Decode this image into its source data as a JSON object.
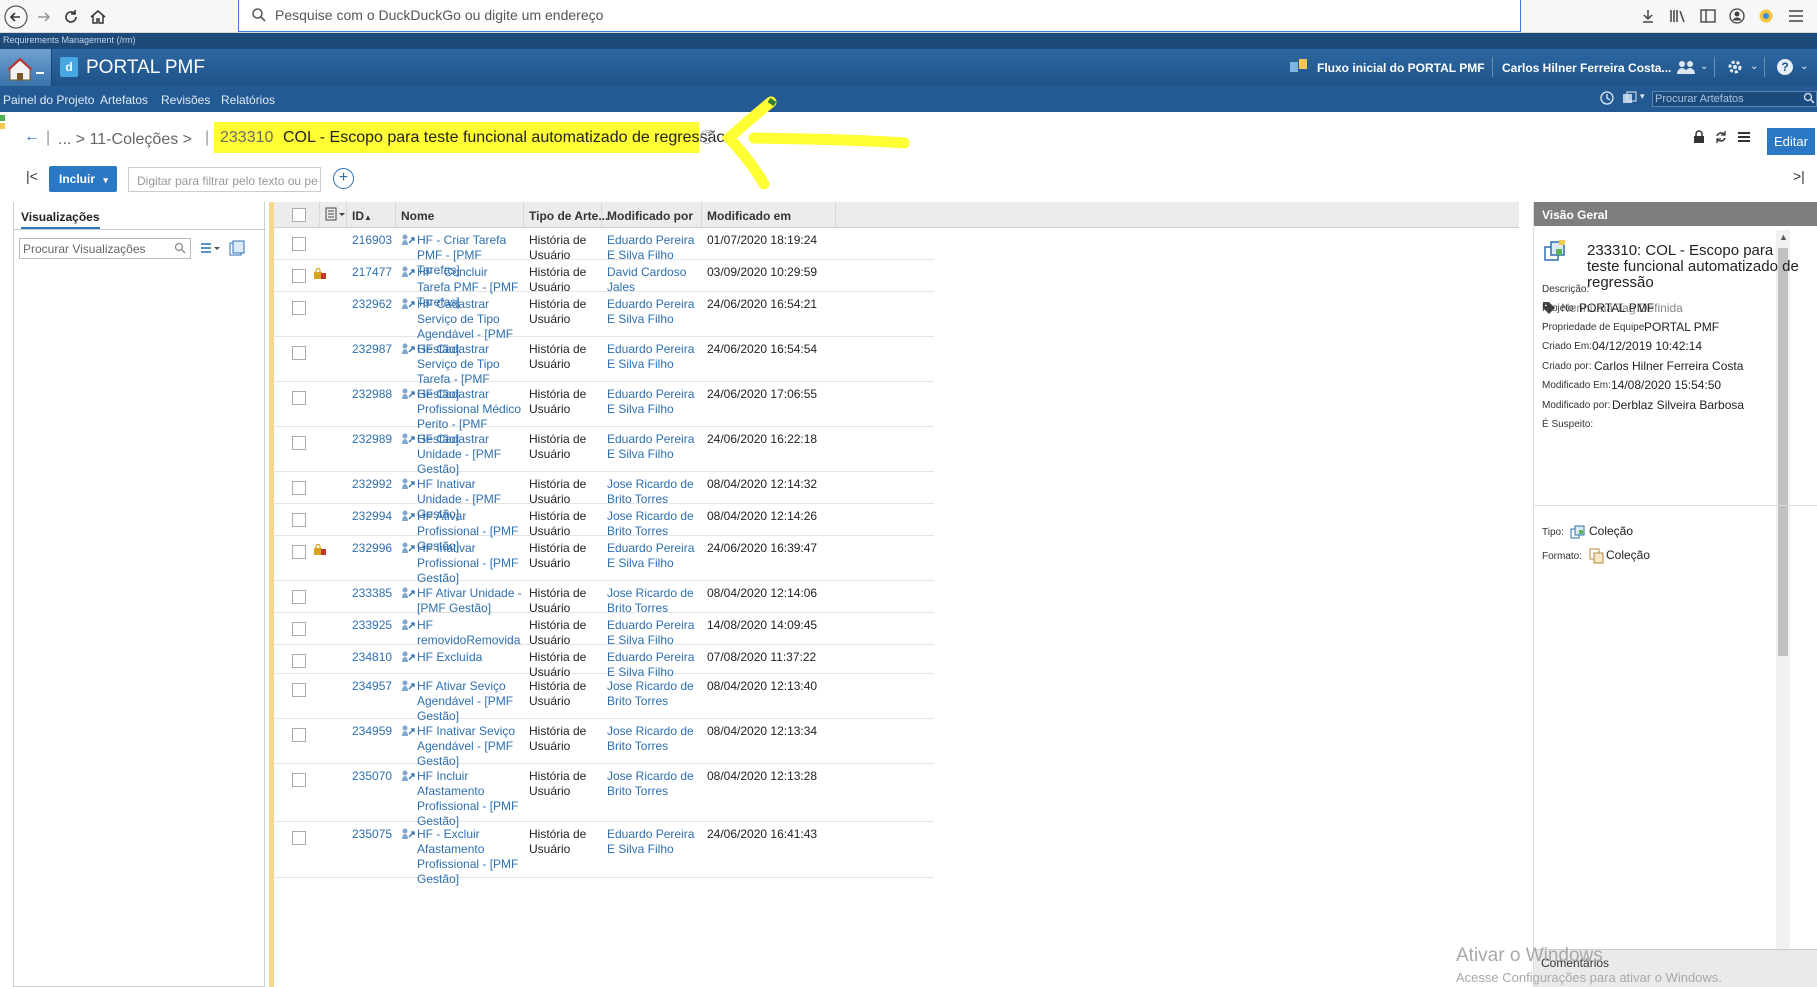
{
  "browser": {
    "url_placeholder": "Pesquise com o DuckDuckGo ou digite um endereço"
  },
  "app": {
    "strip_label": "Requirements Management (/rm)",
    "portal_title": "PORTAL PMF",
    "flow_label": "Fluxo inicial do PORTAL PMF",
    "user_label": "Carlos Hilner Ferreira Costa...",
    "nav": [
      "Painel do Projeto",
      "Artefatos",
      "Revisões",
      "Relatórios"
    ],
    "search_placeholder": "Procurar Artefatos"
  },
  "breadcrumb": {
    "path": "... > 11-Coleções >",
    "collection_id": "233310",
    "collection_title": "COL - Escopo para teste funcional automatizado de regressão",
    "edit_label": "Editar"
  },
  "toolbar": {
    "include_label": "Incluir",
    "filter_placeholder": "Digitar para filtrar pelo texto ou pe"
  },
  "left_panel": {
    "tab_label": "Visualizações",
    "search_placeholder": "Procurar Visualizações"
  },
  "table": {
    "headers": [
      "ID",
      "Nome",
      "Tipo de Arte...",
      "Modificado por",
      "Modificado em"
    ],
    "rows": [
      {
        "id": "216903",
        "name": "HF - Criar Tarefa PMF - [PMF Tarefas]",
        "tipo": "História de Usuário",
        "mod_by": "Eduardo Pereira E Silva Filho",
        "mod_at": "01/07/2020 18:19:24",
        "locked": false
      },
      {
        "id": "217477",
        "name": "HF - Concluir Tarefa PMF - [PMF Tarefas]",
        "tipo": "História de Usuário",
        "mod_by": "David Cardoso Jales",
        "mod_at": "03/09/2020 10:29:59",
        "locked": true
      },
      {
        "id": "232962",
        "name": "HF Cadastrar Serviço de Tipo Agendável - [PMF Gestão]",
        "tipo": "História de Usuário",
        "mod_by": "Eduardo Pereira E Silva Filho",
        "mod_at": "24/06/2020 16:54:21",
        "locked": false
      },
      {
        "id": "232987",
        "name": "HF Cadastrar Serviço de Tipo Tarefa - [PMF Gestão]",
        "tipo": "História de Usuário",
        "mod_by": "Eduardo Pereira E Silva Filho",
        "mod_at": "24/06/2020 16:54:54",
        "locked": false
      },
      {
        "id": "232988",
        "name": "HF Cadastrar Profissional Médico Perito - [PMF Gestão]",
        "tipo": "História de Usuário",
        "mod_by": "Eduardo Pereira E Silva Filho",
        "mod_at": "24/06/2020 17:06:55",
        "locked": false
      },
      {
        "id": "232989",
        "name": "HF Cadastrar Unidade - [PMF Gestão]",
        "tipo": "História de Usuário",
        "mod_by": "Eduardo Pereira E Silva Filho",
        "mod_at": "24/06/2020 16:22:18",
        "locked": false
      },
      {
        "id": "232992",
        "name": "HF Inativar Unidade - [PMF Gestão]",
        "tipo": "História de Usuário",
        "mod_by": "Jose Ricardo de Brito Torres",
        "mod_at": "08/04/2020 12:14:32",
        "locked": false
      },
      {
        "id": "232994",
        "name": "HF Ativar Profissional - [PMF Gestão]",
        "tipo": "História de Usuário",
        "mod_by": "Jose Ricardo de Brito Torres",
        "mod_at": "08/04/2020 12:14:26",
        "locked": false
      },
      {
        "id": "232996",
        "name": "HF Inativar Profissional - [PMF Gestão]",
        "tipo": "História de Usuário",
        "mod_by": "Eduardo Pereira E Silva Filho",
        "mod_at": "24/06/2020 16:39:47",
        "locked": true
      },
      {
        "id": "233385",
        "name": "HF Ativar Unidade - [PMF Gestão]",
        "tipo": "História de Usuário",
        "mod_by": "Jose Ricardo de Brito Torres",
        "mod_at": "08/04/2020 12:14:06",
        "locked": false
      },
      {
        "id": "233925",
        "name": "HF removidoRemovida",
        "tipo": "História de Usuário",
        "mod_by": "Eduardo Pereira E Silva Filho",
        "mod_at": "14/08/2020 14:09:45",
        "locked": false
      },
      {
        "id": "234810",
        "name": "HF Excluída",
        "tipo": "História de Usuário",
        "mod_by": "Eduardo Pereira E Silva Filho",
        "mod_at": "07/08/2020 11:37:22",
        "locked": false
      },
      {
        "id": "234957",
        "name": "HF Ativar Seviço Agendável - [PMF Gestão]",
        "tipo": "História de Usuário",
        "mod_by": "Jose Ricardo de Brito Torres",
        "mod_at": "08/04/2020 12:13:40",
        "locked": false
      },
      {
        "id": "234959",
        "name": "HF Inativar Seviço Agendável - [PMF Gestão]",
        "tipo": "História de Usuário",
        "mod_by": "Jose Ricardo de Brito Torres",
        "mod_at": "08/04/2020 12:13:34",
        "locked": false
      },
      {
        "id": "235070",
        "name": "HF Incluir Afastamento Profissional - [PMF Gestão]",
        "tipo": "História de Usuário",
        "mod_by": "Jose Ricardo de Brito Torres",
        "mod_at": "08/04/2020 12:13:28",
        "locked": false
      },
      {
        "id": "235075",
        "name": "HF - Excluir Afastamento Profissional - [PMF Gestão]",
        "tipo": "História de Usuário",
        "mod_by": "Eduardo Pereira E Silva Filho",
        "mod_at": "24/06/2020 16:41:43",
        "locked": false
      }
    ]
  },
  "overview": {
    "header": "Visão Geral",
    "title": "233310: COL - Escopo para teste funcional automatizado de regressão",
    "no_tags": "Nenhuma Tag Definida",
    "fields": [
      {
        "label": "Descrição:",
        "value": ""
      },
      {
        "label": "Projeto:",
        "value": "PORTAL PMF"
      },
      {
        "label": "Propriedade de Equipe:",
        "value": "PORTAL PMF"
      },
      {
        "label": "Criado Em:",
        "value": "04/12/2019 10:42:14"
      },
      {
        "label": "Criado por:",
        "value": "Carlos Hilner Ferreira Costa"
      },
      {
        "label": "Modificado Em:",
        "value": "14/08/2020 15:54:50"
      },
      {
        "label": "Modificado por:",
        "value": "Derblaz Silveira Barbosa"
      },
      {
        "label": "É Suspeito:",
        "value": ""
      }
    ],
    "tipo_label": "Tipo:",
    "tipo_value": "Coleção",
    "formato_label": "Formato:",
    "formato_value": "Coleção",
    "comments_label": "Comentários"
  },
  "watermark": {
    "line1": "Ativar o Windows",
    "line2": "Acesse Configurações para ativar o Windows."
  },
  "colors": {
    "header_blue": "#1e5288",
    "accent": "#2b78c5",
    "link": "#2d6fb0",
    "highlight": "#ffff33"
  }
}
